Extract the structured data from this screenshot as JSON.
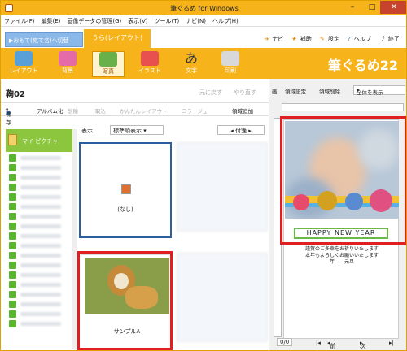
{
  "window": {
    "title": "筆ぐるめ for Windows"
  },
  "menu": [
    "ファイル(F)",
    "編集(E)",
    "画像データの管理(G)",
    "表示(V)",
    "ツール(T)",
    "ナビ(N)",
    "ヘルプ(H)"
  ],
  "tabs": {
    "front": "▶おもて(宛て名)へ切替",
    "back": "うら(レイアウト)"
  },
  "help_links": [
    "ナビ",
    "補助",
    "設定",
    "ヘルプ",
    "終了"
  ],
  "ribbon": [
    "レイアウト",
    "背景",
    "写真",
    "イラスト",
    "文字",
    "印刷"
  ],
  "logo": "筆ぐるめ22",
  "doc": {
    "name": "鞠02",
    "undo": "元に戻す",
    "redo": "やり直す"
  },
  "toolbar": [
    "保存",
    "アルバム化",
    "削除",
    "取込",
    "かんたんレイアウト",
    "コラージュ",
    "領域追加"
  ],
  "album": {
    "title": "マイ ピクチャ"
  },
  "view": {
    "label": "表示",
    "sort": "標準順表示",
    "tag": "付箋"
  },
  "cards": [
    {
      "caption": "(なし)"
    },
    {
      "caption": "サンプルA"
    }
  ],
  "right": {
    "tools": [
      "画",
      "領域設定",
      "領域削除"
    ],
    "zoom": "全体を表示",
    "happy": "HAPPY NEW YEAR",
    "msg1": "謹賀のご多幸をお祈りいたします",
    "msg2": "本年もよろしくお願いいたします",
    "msg3": "年　　元旦",
    "page": "0/0",
    "prev": "前へ",
    "next": "次へ"
  }
}
